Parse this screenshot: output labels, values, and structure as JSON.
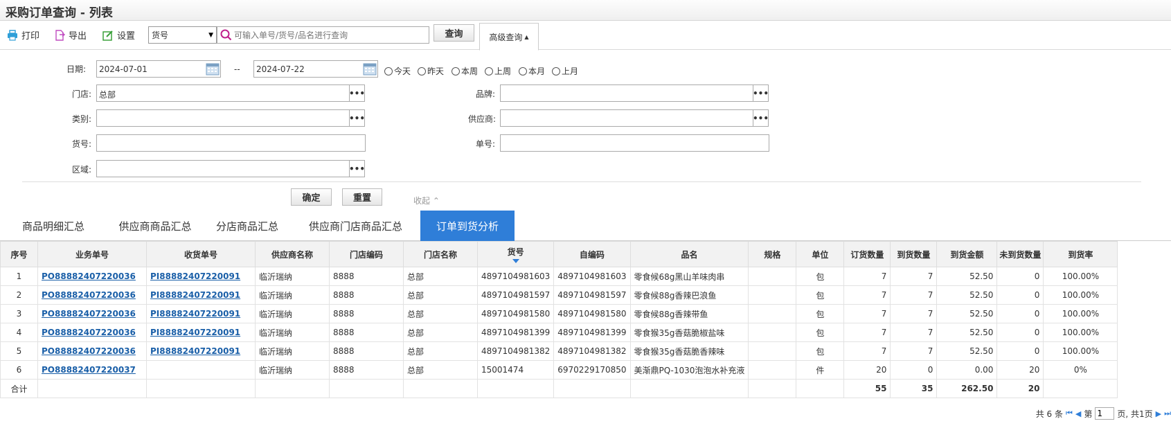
{
  "page": {
    "title": "采购订单查询 - 列表"
  },
  "toolbar": {
    "print": "打印",
    "export": "导出",
    "settings": "设置",
    "field_select": "货号",
    "search_placeholder": "可输入单号/货号/品名进行查询",
    "query": "查询",
    "advanced": "高级查询"
  },
  "filters": {
    "date_label": "日期:",
    "date_from": "2024-07-01",
    "date_sep": "--",
    "date_to": "2024-07-22",
    "quick": [
      "今天",
      "昨天",
      "本周",
      "上周",
      "本月",
      "上月"
    ],
    "store_label": "门店:",
    "store_value": "总部",
    "brand_label": "品牌:",
    "brand_value": "",
    "category_label": "类别:",
    "category_value": "",
    "supplier_label": "供应商:",
    "supplier_value": "",
    "sku_label": "货号:",
    "sku_value": "",
    "order_no_label": "单号:",
    "order_no_value": "",
    "region_label": "区域:",
    "region_value": "",
    "confirm": "确定",
    "reset": "重置",
    "collapse": "收起"
  },
  "tabs": [
    "商品明细汇总",
    "供应商商品汇总",
    "分店商品汇总",
    "供应商门店商品汇总",
    "订单到货分析"
  ],
  "active_tab": 4,
  "table": {
    "columns": [
      "序号",
      "业务单号",
      "收货单号",
      "供应商名称",
      "门店编码",
      "门店名称",
      "货号",
      "自编码",
      "品名",
      "规格",
      "单位",
      "订货数量",
      "到货数量",
      "到货金额",
      "未到货数量",
      "到货率"
    ],
    "rows": [
      [
        "1",
        "PO88882407220036",
        "PI88882407220091",
        "临沂瑞纳",
        "8888",
        "总部",
        "4897104981603",
        "4897104981603",
        "零食候68g黑山羊味肉串",
        "",
        "包",
        "7",
        "7",
        "52.50",
        "0",
        "100.00%"
      ],
      [
        "2",
        "PO88882407220036",
        "PI88882407220091",
        "临沂瑞纳",
        "8888",
        "总部",
        "4897104981597",
        "4897104981597",
        "零食候88g香辣巴浪鱼",
        "",
        "包",
        "7",
        "7",
        "52.50",
        "0",
        "100.00%"
      ],
      [
        "3",
        "PO88882407220036",
        "PI88882407220091",
        "临沂瑞纳",
        "8888",
        "总部",
        "4897104981580",
        "4897104981580",
        "零食候88g香辣带鱼",
        "",
        "包",
        "7",
        "7",
        "52.50",
        "0",
        "100.00%"
      ],
      [
        "4",
        "PO88882407220036",
        "PI88882407220091",
        "临沂瑞纳",
        "8888",
        "总部",
        "4897104981399",
        "4897104981399",
        "零食猴35g香菇脆椒盐味",
        "",
        "包",
        "7",
        "7",
        "52.50",
        "0",
        "100.00%"
      ],
      [
        "5",
        "PO88882407220036",
        "PI88882407220091",
        "临沂瑞纳",
        "8888",
        "总部",
        "4897104981382",
        "4897104981382",
        "零食猴35g香菇脆香辣味",
        "",
        "包",
        "7",
        "7",
        "52.50",
        "0",
        "100.00%"
      ],
      [
        "6",
        "PO88882407220037",
        "",
        "临沂瑞纳",
        "8888",
        "总部",
        "15001474",
        "6970229170850",
        "美渐鼎PQ-1030泡泡水补充液",
        "",
        "件",
        "20",
        "0",
        "0.00",
        "20",
        "0%"
      ]
    ],
    "total_label": "合计",
    "totals": {
      "order_qty": "55",
      "arrived_qty": "35",
      "arrived_amount": "262.50",
      "not_arrived_qty": "20"
    }
  },
  "pager": {
    "total": "共 6 条",
    "page_prefix": "第",
    "page": "1",
    "page_suffix": "页, 共1页"
  },
  "colors": {
    "accent": "#2f7ed8",
    "link": "#1a5fa8",
    "header_bg": "#f2f2f2"
  }
}
